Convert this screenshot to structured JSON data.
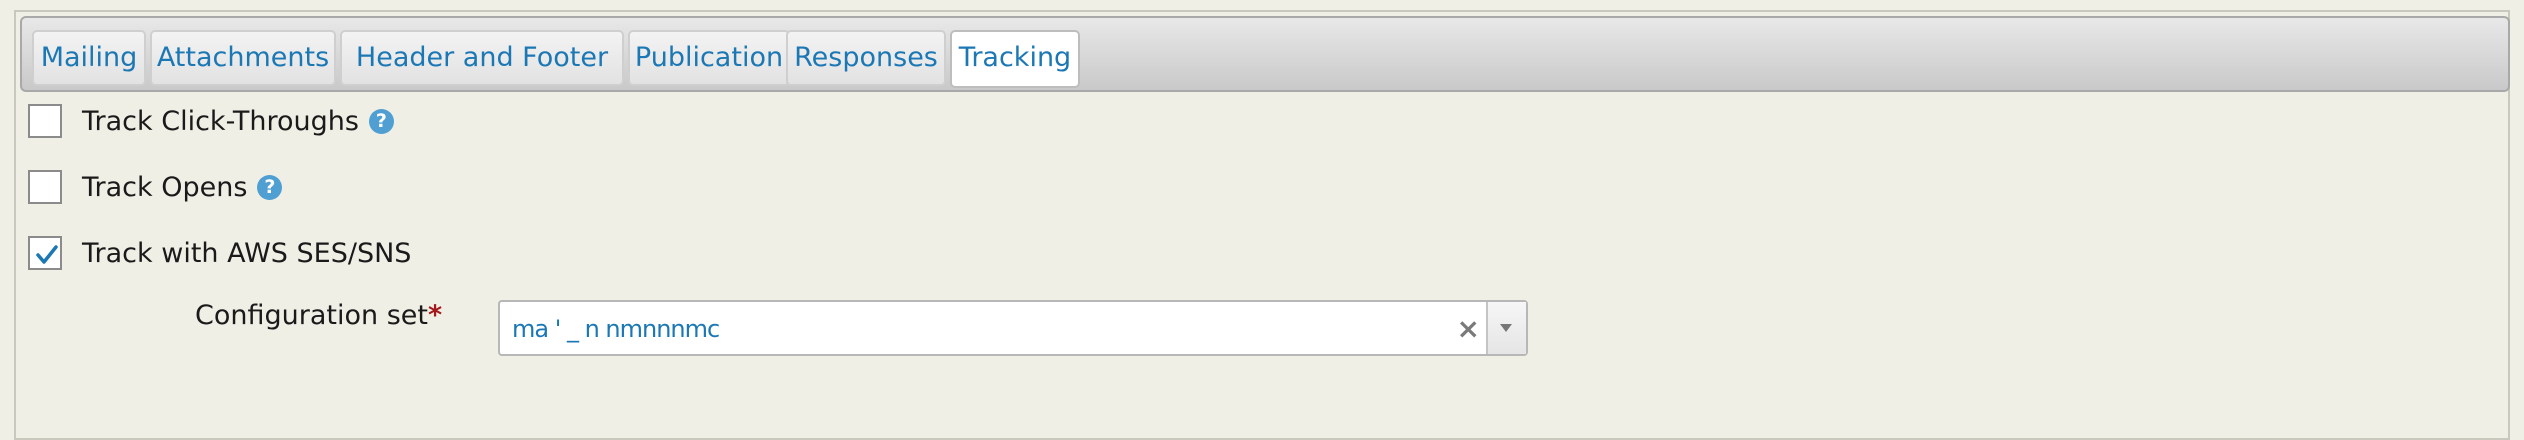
{
  "tabs": [
    {
      "label": "Mailing",
      "active": false
    },
    {
      "label": "Attachments",
      "active": false
    },
    {
      "label": "Header and Footer",
      "active": false
    },
    {
      "label": "Publication",
      "active": false
    },
    {
      "label": "Responses",
      "active": false
    },
    {
      "label": "Tracking",
      "active": true
    }
  ],
  "tracking": {
    "click_throughs": {
      "label": "Track Click-Throughs",
      "checked": false,
      "help_icon": "?"
    },
    "opens": {
      "label": "Track Opens",
      "checked": false,
      "help_icon": "?"
    },
    "aws": {
      "label": "Track with AWS SES/SNS",
      "checked": true
    }
  },
  "config_set": {
    "label": "Configuration set",
    "required_marker": "*",
    "value": "ma ' _ n  nmnnnmc",
    "clear_icon": "×"
  },
  "colors": {
    "accent": "#1b78b5",
    "help": "#4f9fd3",
    "required": "#a4161a",
    "background": "#f0efe6"
  },
  "icons": {
    "help": "help-circle-icon",
    "check": "checkmark-icon",
    "clear": "clear-icon",
    "dropdown": "chevron-down-icon"
  }
}
